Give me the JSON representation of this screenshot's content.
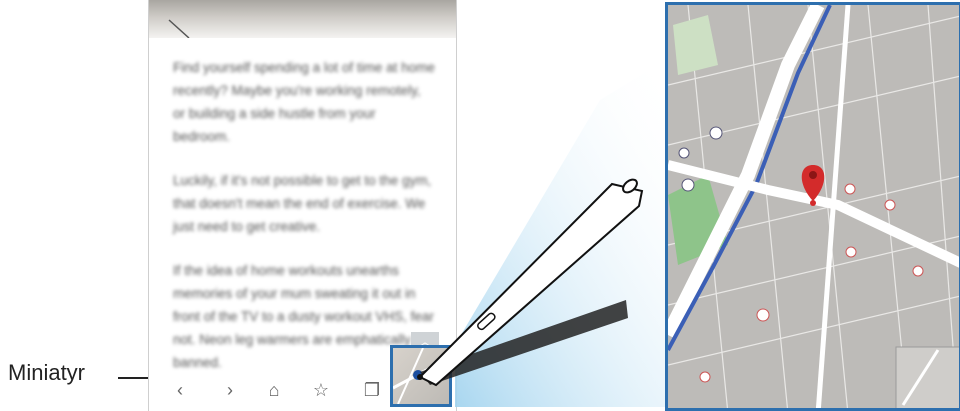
{
  "callout": {
    "label": "Miniatyr"
  },
  "article": {
    "paragraphs": [
      "Find yourself spending a lot of time at home recently? Maybe you're working remotely, or building a side hustle from your bedroom.",
      "Luckily, if it's not possible to get to the gym, that doesn't mean the end of exercise. We just need to get creative.",
      "If the idea of home workouts unearths memories of your mum sweating it out in front of the TV to a dusty workout VHS, fear not. Neon leg warmers are emphatically banned."
    ]
  },
  "nav": {
    "back": "‹",
    "forward": "›",
    "home": "⌂",
    "favorites": "☆",
    "tabs": "❐",
    "scroll_up": "︿"
  },
  "colors": {
    "accent": "#2d6fae",
    "map_road": "#ffffff",
    "map_river": "#3b5fb6",
    "pin": "#d32b2b",
    "park": "#8ec48a"
  }
}
